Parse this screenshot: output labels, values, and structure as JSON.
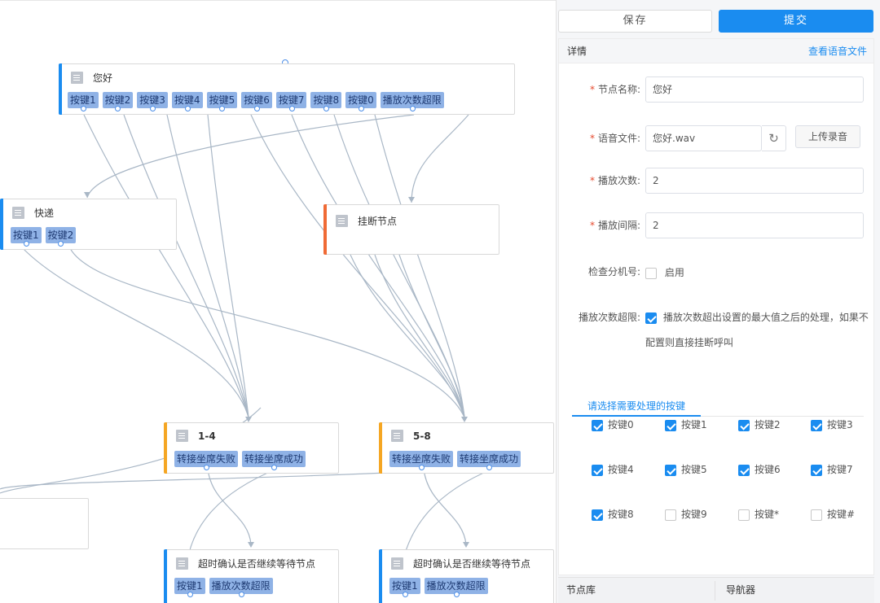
{
  "nodes": {
    "hello": {
      "title": "您好",
      "keys": [
        "按键1",
        "按键2",
        "按键3",
        "按键4",
        "按键5",
        "按键6",
        "按键7",
        "按键8",
        "按键0",
        "播放次数超限"
      ],
      "accent": "#1a8cf0"
    },
    "express": {
      "title": "快递",
      "keys": [
        "按键1",
        "按键2"
      ],
      "accent": "#1a8cf0"
    },
    "hangup": {
      "title": "挂断节点",
      "keys": [],
      "accent": "#f06a35"
    },
    "r14": {
      "title": "1-4",
      "keys": [
        "转接坐席失败",
        "转接坐席成功"
      ],
      "accent": "#f5a623"
    },
    "r58": {
      "title": "5-8",
      "keys": [
        "转接坐席失败",
        "转接坐席成功"
      ],
      "accent": "#f5a623"
    },
    "timeout1": {
      "title": "超时确认是否继续等待节点",
      "keys": [
        "按键1",
        "播放次数超限"
      ],
      "accent": "#1a8cf0"
    },
    "timeout2": {
      "title": "超时确认是否继续等待节点",
      "keys": [
        "按键1",
        "播放次数超限"
      ],
      "accent": "#1a8cf0"
    }
  },
  "toolbar": {
    "save": "保存",
    "submit": "提交"
  },
  "detail": {
    "title": "详情",
    "voice_link": "查看语音文件",
    "node_name_label": "节点名称:",
    "node_name_value": "您好",
    "voice_file_label": "语音文件:",
    "voice_file_value": "您好.wav",
    "upload_label": "上传录音",
    "play_count_label": "播放次数:",
    "play_count_value": "2",
    "play_interval_label": "播放间隔:",
    "play_interval_value": "2",
    "check_ext_label": "检查分机号:",
    "check_ext_option": "启用",
    "check_ext_checked": false,
    "over_limit_label": "播放次数超限:",
    "over_limit_text_1": "播放次数超出设置的最大值之后的处理，如果不",
    "over_limit_text_2": "配置则直接挂断呼叫",
    "over_limit_checked": true,
    "keys_tab": "请选择需要处理的按键"
  },
  "key_options": [
    {
      "label": "按键0",
      "checked": true
    },
    {
      "label": "按键1",
      "checked": true
    },
    {
      "label": "按键2",
      "checked": true
    },
    {
      "label": "按键3",
      "checked": true
    },
    {
      "label": "按键4",
      "checked": true
    },
    {
      "label": "按键5",
      "checked": true
    },
    {
      "label": "按键6",
      "checked": true
    },
    {
      "label": "按键7",
      "checked": true
    },
    {
      "label": "按键8",
      "checked": true
    },
    {
      "label": "按键9",
      "checked": false
    },
    {
      "label": "按键*",
      "checked": false
    },
    {
      "label": "按键#",
      "checked": false
    }
  ],
  "bottom_tabs": {
    "library": "节点库",
    "navigator": "导航器"
  },
  "colors": {
    "primary": "#1a8cf0",
    "key_chip": "#8fb2e6",
    "wire": "#a9b7c6"
  }
}
